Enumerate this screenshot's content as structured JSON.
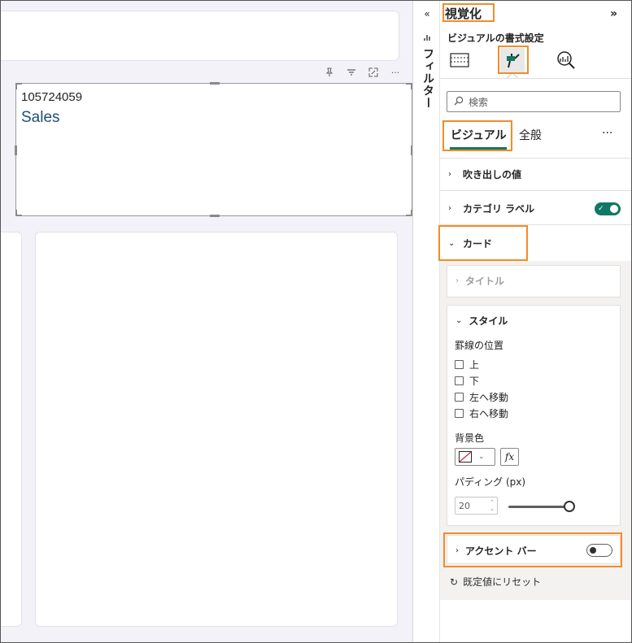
{
  "canvas": {
    "card": {
      "value": "105724059",
      "category_label": "Sales"
    },
    "toolbar_icons": [
      "pin-icon",
      "filter-icon",
      "focus-mode-icon",
      "more-options-icon"
    ]
  },
  "filters": {
    "label": "フィルター"
  },
  "viz_pane": {
    "title": "視覚化",
    "subtitle": "ビジュアルの書式設定",
    "search": {
      "placeholder": "検索"
    },
    "tabs": [
      {
        "label": "ビジュアル",
        "active": true
      },
      {
        "label": "全般",
        "active": false
      }
    ],
    "more_label": "···",
    "sections": {
      "callout": {
        "label": "吹き出しの値"
      },
      "category_label": {
        "label": "カテゴリ ラベル",
        "toggle": true
      },
      "card": {
        "label": "カード",
        "expanded": true
      }
    },
    "card_sub": {
      "title": {
        "label": "タイトル"
      },
      "style": {
        "label": "スタイル",
        "border_position_label": "罫線の位置",
        "border_options": [
          "上",
          "下",
          "左へ移動",
          "右へ移動"
        ],
        "background_color_label": "背景色",
        "fx_label": "fx",
        "padding_label": "パディング (px)",
        "padding_value": "20"
      },
      "accent_bar": {
        "label": "アクセント バー",
        "toggle": false
      }
    },
    "reset_label": "既定値にリセット"
  },
  "colors": {
    "accent": "#117865",
    "highlight": "#f28c28",
    "card_label": "#1f4e79"
  }
}
